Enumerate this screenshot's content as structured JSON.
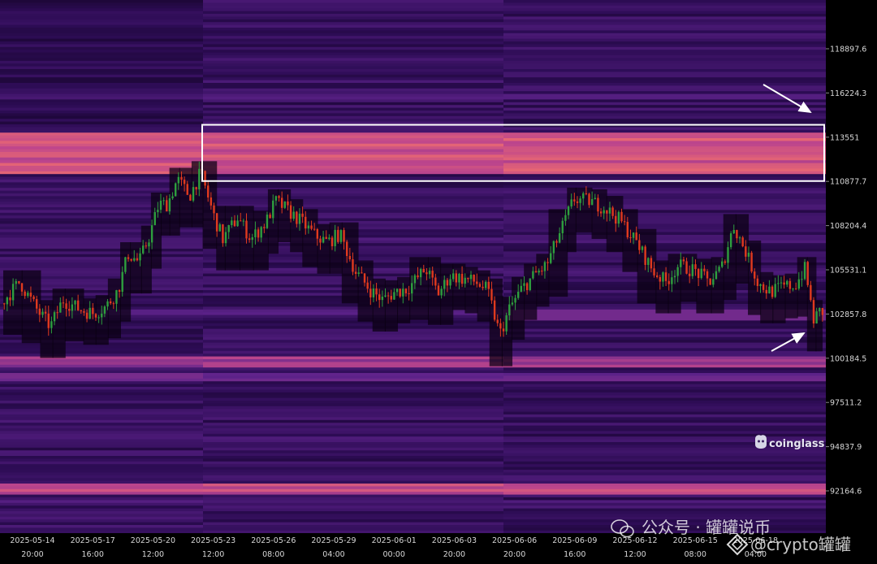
{
  "chart_data": {
    "type": "heatmap",
    "title": "",
    "xlabel": "",
    "ylabel": "",
    "ylim": [
      90900,
      121500
    ],
    "y_ticks": [
      "118897.6",
      "116224.3",
      "113551",
      "110877.7",
      "108204.4",
      "105531.1",
      "102857.8",
      "100184.5",
      "97511.2",
      "94837.9",
      "92164.6"
    ],
    "x_ticks": [
      {
        "date": "2025-05-14",
        "time": "20:00"
      },
      {
        "date": "2025-05-17",
        "time": "16:00"
      },
      {
        "date": "2025-05-20",
        "time": "12:00"
      },
      {
        "date": "2025-05-23",
        "time": "12:00"
      },
      {
        "date": "2025-05-26",
        "time": "08:00"
      },
      {
        "date": "2025-05-29",
        "time": "04:00"
      },
      {
        "date": "2025-06-01",
        "time": "00:00"
      },
      {
        "date": "2025-06-03",
        "time": "20:00"
      },
      {
        "date": "2025-06-06",
        "time": "20:00"
      },
      {
        "date": "2025-06-09",
        "time": "16:00"
      },
      {
        "date": "2025-06-12",
        "time": "12:00"
      },
      {
        "date": "2025-06-15",
        "time": "08:00"
      },
      {
        "date": "2025-06-18",
        "time": "04:00"
      }
    ],
    "price_path": [
      [
        0,
        103500
      ],
      [
        1.5,
        104800
      ],
      [
        3,
        103000
      ],
      [
        4,
        102100
      ],
      [
        5,
        103700
      ],
      [
        6.5,
        103100
      ],
      [
        7.5,
        102900
      ],
      [
        8.5,
        103300
      ],
      [
        9.5,
        104300
      ],
      [
        10.3,
        106500
      ],
      [
        11.2,
        106000
      ],
      [
        12,
        107500
      ],
      [
        12.8,
        109500
      ],
      [
        13.5,
        109500
      ],
      [
        14.3,
        111000
      ],
      [
        15.3,
        110000
      ],
      [
        16.2,
        111400
      ],
      [
        17.3,
        108700
      ],
      [
        18,
        107400
      ],
      [
        19.2,
        108700
      ],
      [
        20.3,
        107400
      ],
      [
        21.5,
        108400
      ],
      [
        22.3,
        109700
      ],
      [
        23.3,
        109100
      ],
      [
        24.3,
        108500
      ],
      [
        25.5,
        107600
      ],
      [
        26.5,
        107200
      ],
      [
        27.5,
        107700
      ],
      [
        28.8,
        105400
      ],
      [
        30,
        104300
      ],
      [
        31,
        103700
      ],
      [
        32,
        104200
      ],
      [
        33,
        104400
      ],
      [
        34.5,
        105600
      ],
      [
        35.5,
        104100
      ],
      [
        36.5,
        105200
      ],
      [
        37.5,
        105000
      ],
      [
        38.5,
        104800
      ],
      [
        39.5,
        104300
      ],
      [
        40.5,
        101600
      ],
      [
        41.3,
        103200
      ],
      [
        42.3,
        104400
      ],
      [
        43.3,
        105200
      ],
      [
        44.3,
        105800
      ],
      [
        45.8,
        108500
      ],
      [
        46.5,
        109800
      ],
      [
        47.8,
        109700
      ],
      [
        49,
        109300
      ],
      [
        50.3,
        108500
      ],
      [
        51.5,
        107300
      ],
      [
        53,
        105400
      ],
      [
        54,
        104800
      ],
      [
        55,
        105800
      ],
      [
        56.3,
        105500
      ],
      [
        57.5,
        104800
      ],
      [
        58.5,
        105600
      ],
      [
        59.5,
        108200
      ],
      [
        60.5,
        106600
      ],
      [
        61.5,
        104700
      ],
      [
        62.5,
        104200
      ],
      [
        63.5,
        104500
      ],
      [
        64.5,
        104600
      ],
      [
        65.3,
        105600
      ],
      [
        66,
        102500
      ],
      [
        66.5,
        103000
      ]
    ],
    "annotations": [
      "coinglass"
    ]
  },
  "watermark": {
    "text": "公众号 · 罐罐说币",
    "brand_text": "@crypto罐罐"
  },
  "colors": {
    "background": "#000000",
    "heat_low": "#2a0a4d",
    "heat_mid": "#6a2a8a",
    "heat_high": "#e07070",
    "up": "#2e9e3e",
    "down": "#e03a1e",
    "highlight_box": "#ffffff",
    "arrow": "#ffffff"
  }
}
